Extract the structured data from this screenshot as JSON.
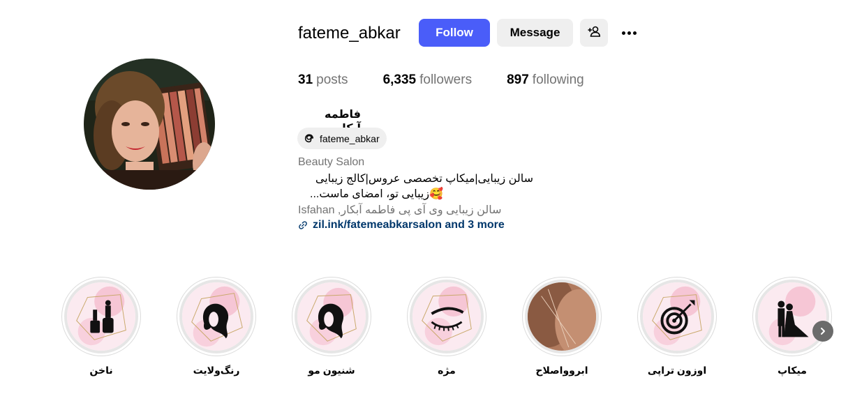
{
  "profile": {
    "username": "fateme_abkar",
    "full_name": "فاطمه آبکار",
    "threads_handle": "fateme_abkar",
    "category": "Beauty Salon",
    "bio_line1": "سالن زیبایی|میکاپ تخصصی عروس|کالج زیبایی",
    "bio_line2": "🥰زیبایی تو، امضای ماست...",
    "address": "Isfahan ,سالن زیبایی وی آی پی فاطمه آبکار",
    "link": "zil.ink/fatemeabkarsalon and 3 more"
  },
  "actions": {
    "follow_label": "Follow",
    "message_label": "Message"
  },
  "stats": {
    "posts_count": "31",
    "posts_label": "posts",
    "followers_count": "6,335",
    "followers_label": "followers",
    "following_count": "897",
    "following_label": "following"
  },
  "highlights": [
    {
      "label": "ناخن",
      "icon": "nail-polish-icon"
    },
    {
      "label": "رنگ‌ولایت",
      "icon": "hair-color-icon"
    },
    {
      "label": "شنیون مو",
      "icon": "hair-style-icon"
    },
    {
      "label": "مژه",
      "icon": "eyelash-icon"
    },
    {
      "label": "ابرو‌واصلاح",
      "icon": "eyebrow-photo"
    },
    {
      "label": "اوزون تراپی",
      "icon": "target-icon"
    },
    {
      "label": "میکاپ",
      "icon": "bride-groom-icon"
    }
  ],
  "colors": {
    "accent": "#4a5df9",
    "link": "#00376b",
    "muted": "#737373",
    "button_bg": "#efefef"
  }
}
